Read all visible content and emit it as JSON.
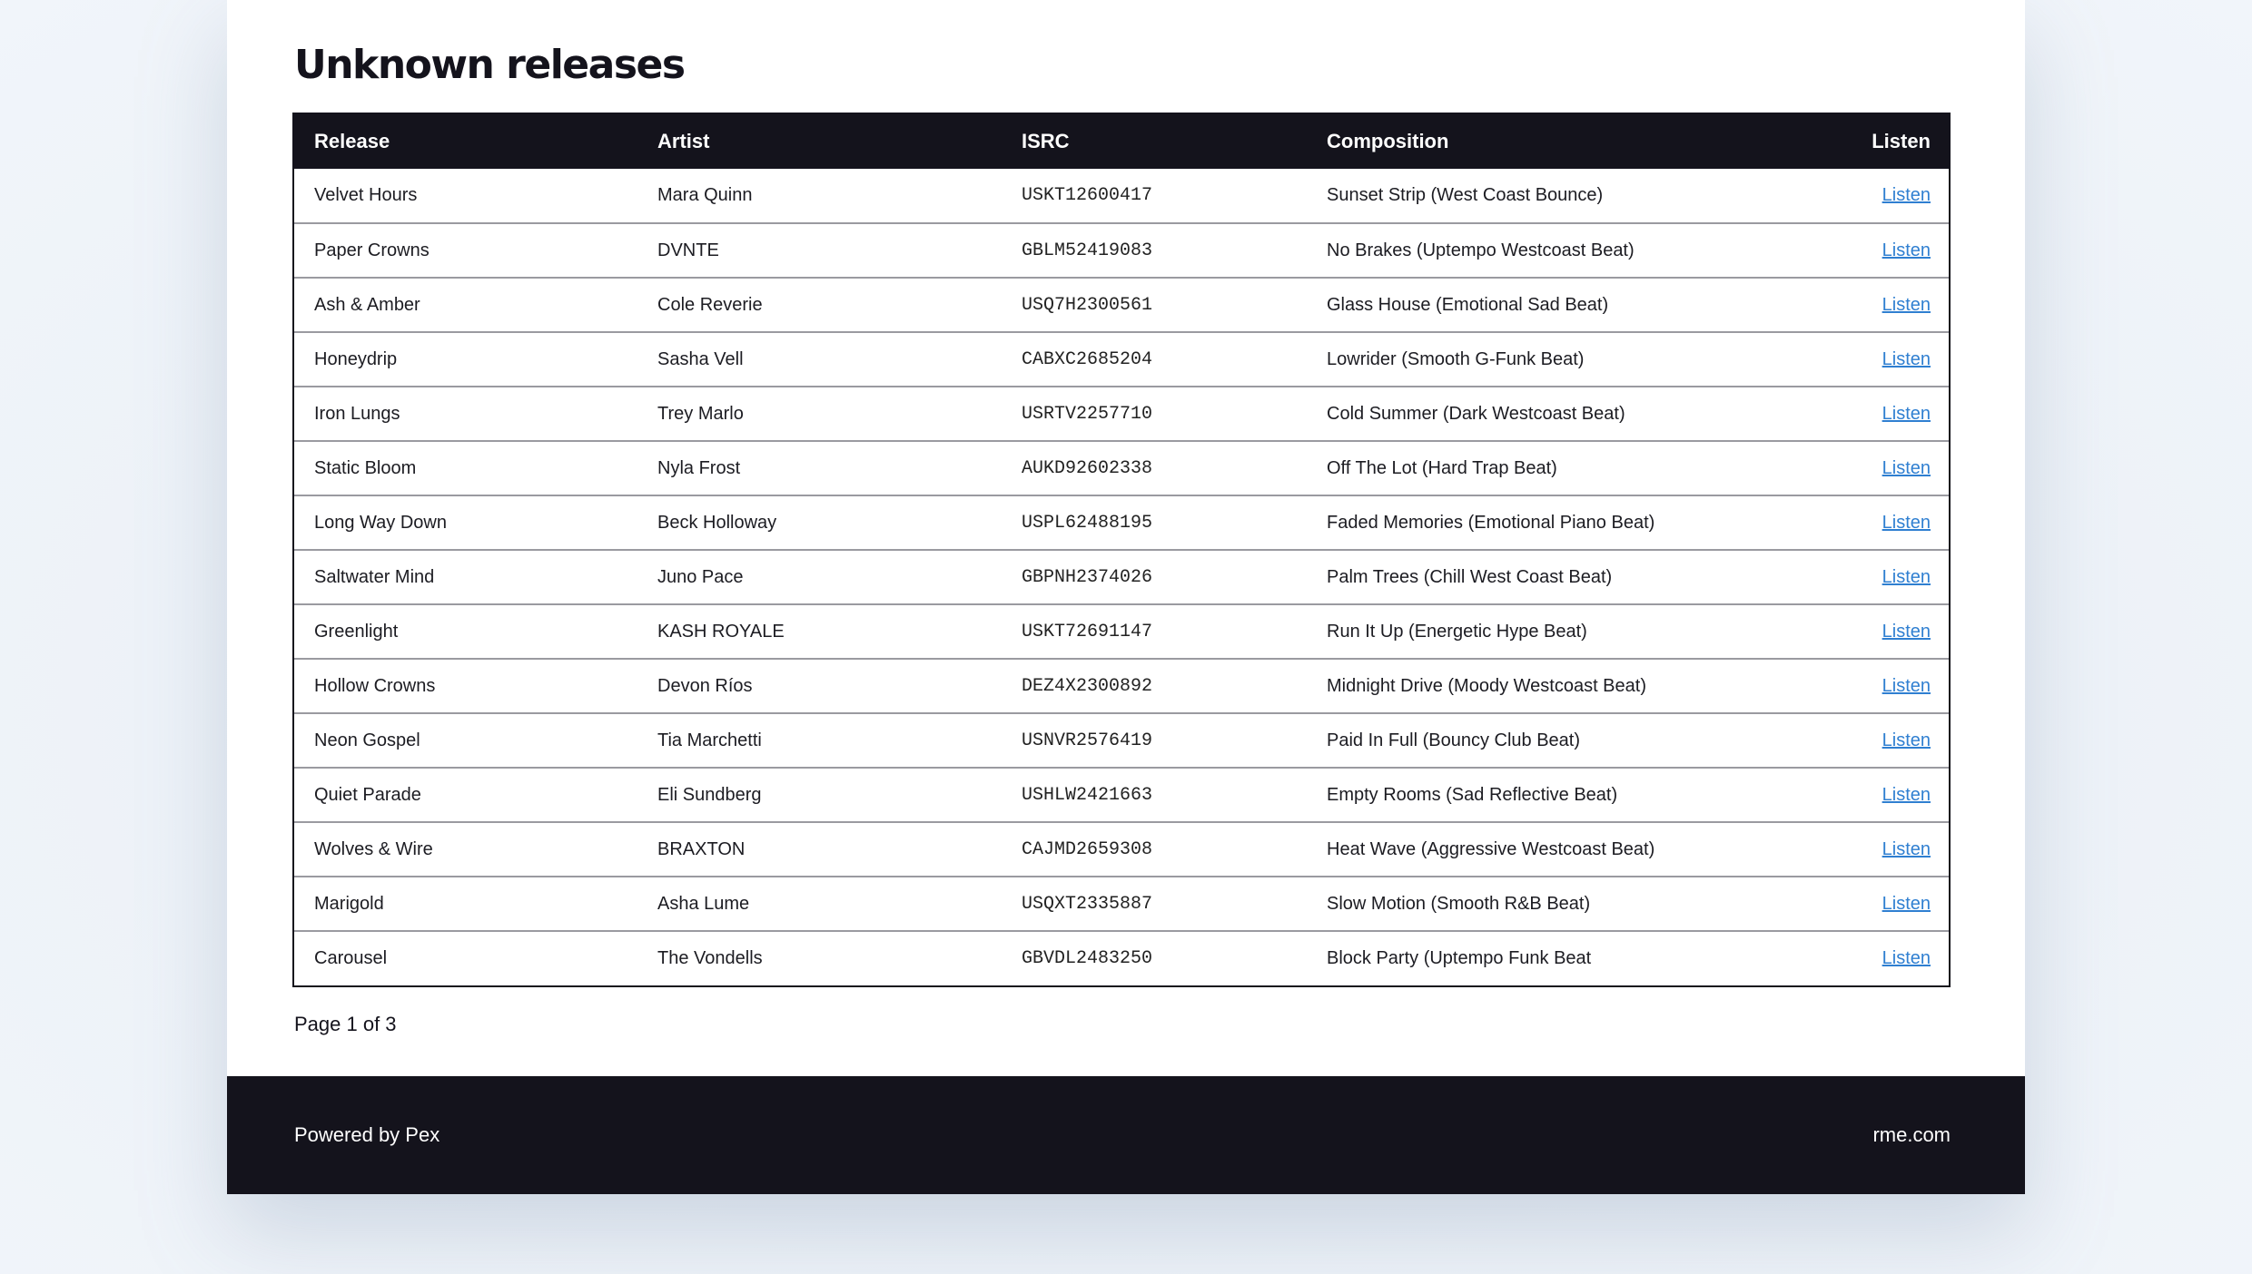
{
  "page": {
    "title": "Unknown releases",
    "pagination": "Page 1 of 3"
  },
  "table": {
    "headers": {
      "release": "Release",
      "artist": "Artist",
      "isrc": "ISRC",
      "composition": "Composition",
      "listen": "Listen"
    },
    "rows": [
      {
        "release": "Velvet Hours",
        "artist": "Mara Quinn",
        "isrc": "USKT12600417",
        "composition": "Sunset Strip (West Coast Bounce)",
        "listen": "Listen"
      },
      {
        "release": "Paper Crowns",
        "artist": "DVNTE",
        "isrc": "GBLM52419083",
        "composition": "No Brakes (Uptempo Westcoast Beat)",
        "listen": "Listen"
      },
      {
        "release": "Ash & Amber",
        "artist": "Cole Reverie",
        "isrc": "USQ7H2300561",
        "composition": "Glass House (Emotional Sad Beat)",
        "listen": "Listen"
      },
      {
        "release": "Honeydrip",
        "artist": "Sasha Vell",
        "isrc": "CABXC2685204",
        "composition": "Lowrider (Smooth G-Funk Beat)",
        "listen": "Listen"
      },
      {
        "release": "Iron Lungs",
        "artist": "Trey Marlo",
        "isrc": "USRTV2257710",
        "composition": "Cold Summer (Dark Westcoast Beat)",
        "listen": "Listen"
      },
      {
        "release": "Static Bloom",
        "artist": "Nyla Frost",
        "isrc": "AUKD92602338",
        "composition": "Off The Lot (Hard Trap Beat)",
        "listen": "Listen"
      },
      {
        "release": "Long Way Down",
        "artist": "Beck Holloway",
        "isrc": "USPL62488195",
        "composition": "Faded Memories (Emotional Piano Beat)",
        "listen": "Listen"
      },
      {
        "release": "Saltwater Mind",
        "artist": "Juno Pace",
        "isrc": "GBPNH2374026",
        "composition": "Palm Trees (Chill West Coast Beat)",
        "listen": "Listen"
      },
      {
        "release": "Greenlight",
        "artist": "KASH ROYALE",
        "isrc": "USKT72691147",
        "composition": "Run It Up (Energetic Hype Beat)",
        "listen": "Listen"
      },
      {
        "release": "Hollow Crowns",
        "artist": "Devon Ríos",
        "isrc": "DEZ4X2300892",
        "composition": "Midnight Drive (Moody Westcoast Beat)",
        "listen": "Listen"
      },
      {
        "release": "Neon Gospel",
        "artist": "Tia Marchetti",
        "isrc": "USNVR2576419",
        "composition": "Paid In Full (Bouncy Club Beat)",
        "listen": "Listen"
      },
      {
        "release": "Quiet Parade",
        "artist": "Eli Sundberg",
        "isrc": "USHLW2421663",
        "composition": "Empty Rooms (Sad Reflective Beat)",
        "listen": "Listen"
      },
      {
        "release": "Wolves & Wire",
        "artist": "BRAXTON",
        "isrc": "CAJMD2659308",
        "composition": "Heat Wave (Aggressive Westcoast Beat)",
        "listen": "Listen"
      },
      {
        "release": "Marigold",
        "artist": "Asha Lume",
        "isrc": "USQXT2335887",
        "composition": "Slow Motion (Smooth R&B Beat)",
        "listen": "Listen"
      },
      {
        "release": "Carousel",
        "artist": "The Vondells",
        "isrc": "GBVDL2483250",
        "composition": "Block Party (Uptempo Funk Beat",
        "listen": "Listen"
      }
    ]
  },
  "footer": {
    "left": "Powered by Pex",
    "right": "rme.com"
  },
  "colors": {
    "dark": "#14131c",
    "link": "#2f7fd1",
    "background": "#edf2f8"
  }
}
